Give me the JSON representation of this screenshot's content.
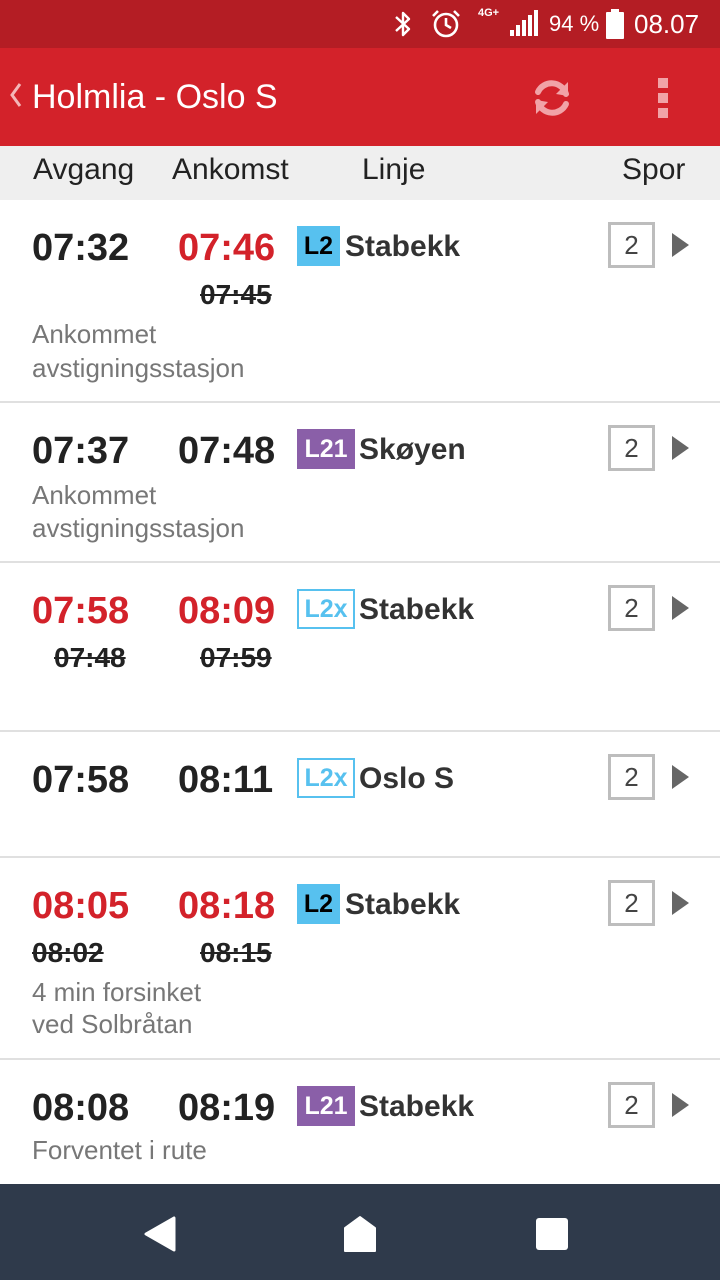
{
  "status_bar": {
    "network": "4G+",
    "battery_percent": "94 %",
    "time": "08.07",
    "icons": [
      "bluetooth-icon",
      "alarm-icon",
      "signal-icon",
      "battery-icon"
    ]
  },
  "toolbar": {
    "title": "Holmlia - Oslo S",
    "icons": [
      "back-chevron-icon",
      "refresh-icon",
      "more-vert-icon"
    ],
    "color": "#d3222a"
  },
  "columns": {
    "departure": "Avgang",
    "arrival": "Ankomst",
    "line": "Linje",
    "track": "Spor"
  },
  "departures": [
    {
      "dep": "07:32",
      "arr": "07:46",
      "arr_old": "07:45",
      "line": "L2",
      "dest": "Stabekk",
      "track": "2",
      "status_line1": "Ankommet",
      "status_line2": "avstigningsstasjon"
    },
    {
      "dep": "07:37",
      "arr": "07:48",
      "line": "L21",
      "dest": "Skøyen",
      "track": "2",
      "status_line1": "Ankommet",
      "status_line2": "avstigningsstasjon"
    },
    {
      "dep": "07:58",
      "dep_old": "07:48",
      "arr": "08:09",
      "arr_old": "07:59",
      "line": "L2x",
      "dest": "Stabekk",
      "track": "2"
    },
    {
      "dep": "07:58",
      "arr": "08:11",
      "line": "L2x",
      "dest": "Oslo S",
      "track": "2"
    },
    {
      "dep": "08:05",
      "dep_old": "08:02",
      "arr": "08:18",
      "arr_old": "08:15",
      "line": "L2",
      "dest": "Stabekk",
      "track": "2",
      "status_line1": "4 min forsinket",
      "status_line2": "ved Solbråtan"
    },
    {
      "dep": "08:08",
      "arr": "08:19",
      "line": "L21",
      "dest": "Stabekk",
      "track": "2",
      "status_line1": "Forventet i rute"
    }
  ],
  "colors": {
    "delay_red": "#d3222a",
    "line_L2": "#57c1ef",
    "line_L21": "#8a5fa8",
    "nav_bar": "#2f3a4b"
  },
  "nav_icons": [
    "nav-back-icon",
    "nav-home-icon",
    "nav-recent-icon"
  ]
}
